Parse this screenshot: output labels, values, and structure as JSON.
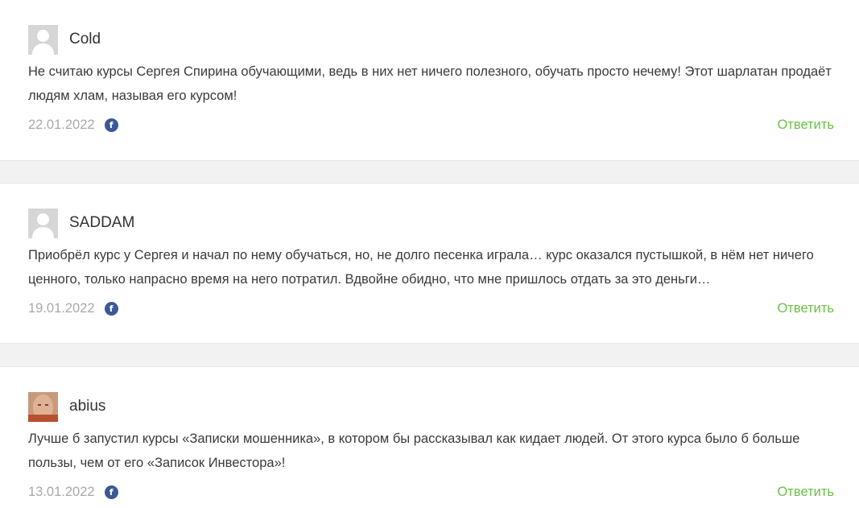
{
  "comments": [
    {
      "author": "Cold",
      "avatar": "default-avatar",
      "text": "Не считаю курсы Сергея Спирина обучающими, ведь в них нет ничего полезного, обучать просто нечему! Этот шарлатан продаёт людям хлам, называя его курсом!",
      "date": "22.01.2022",
      "reply_label": "Ответить",
      "social_icon": "facebook-icon",
      "social_glyph": "f"
    },
    {
      "author": "SADDAM",
      "avatar": "default-avatar",
      "text": "Приобрёл курс у Сергея и начал по нему обучаться, но, не долго песенка играла… курс оказался пустышкой, в нём нет ничего ценного, только напрасно время на него потратил. Вдвойне обидно, что мне пришлось отдать за это деньги…",
      "date": "19.01.2022",
      "reply_label": "Ответить",
      "social_icon": "facebook-icon",
      "social_glyph": "f"
    },
    {
      "author": "abius",
      "avatar": "user-photo",
      "text": "Лучше б запустил курсы «Записки мошенника», в котором бы рассказывал как кидает людей. От этого курса было б больше пользы, чем от его «Записок Инвестора»!",
      "date": "13.01.2022",
      "reply_label": "Ответить",
      "social_icon": "facebook-icon",
      "social_glyph": "f"
    }
  ],
  "colors": {
    "reply": "#6abf45",
    "facebook": "#3b5998",
    "date": "#a9a9a9",
    "separator": "#f2f2f2"
  }
}
